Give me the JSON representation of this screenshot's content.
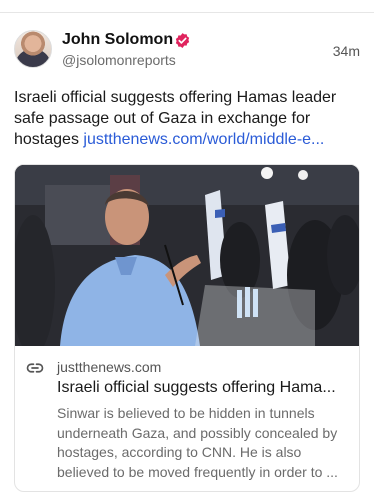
{
  "post": {
    "author_name": "John Solomon",
    "author_handle": "@jsolomonreports",
    "timestamp": "34m",
    "text": "Israeli official suggests offering Hamas leader safe passage out of Gaza in exchange for hostages",
    "link_text": "justthenews.com/world/middle-e..."
  },
  "link_card": {
    "domain": "justthenews.com",
    "title": "Israeli official suggests offering Hama...",
    "description": "Sinwar is believed to be hidden in tunnels underneath Gaza, and possibly concealed by hostages, according to CNN. He is also believed to be moved frequently in order to ..."
  },
  "icons": {
    "verified": "verified-badge-icon",
    "link": "link-icon"
  },
  "colors": {
    "link": "#2a5bd7",
    "verified_badge": "#e0245e",
    "muted_text": "#6b6b6b"
  }
}
